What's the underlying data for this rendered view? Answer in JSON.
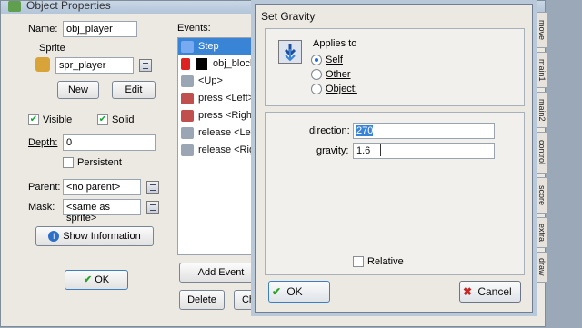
{
  "object_window": {
    "title": "Object Properties",
    "name_label": "Name:",
    "name_value": "obj_player",
    "sprite_label": "Sprite",
    "sprite_value": "spr_player",
    "new_label": "New",
    "edit_label": "Edit",
    "visible_label": "Visible",
    "solid_label": "Solid",
    "depth_label": "Depth:",
    "depth_value": "0",
    "persistent_label": "Persistent",
    "parent_label": "Parent:",
    "parent_value": "<no parent>",
    "mask_label": "Mask:",
    "mask_value": "<same as sprite>",
    "show_info_label": "Show Information",
    "ok_label": "OK",
    "events_label": "Events:",
    "events": [
      {
        "label": "Step",
        "icon": "step-icon"
      },
      {
        "label": "obj_block",
        "icon": "collision-icon"
      },
      {
        "label": "<Up>",
        "icon": "keyboard-icon"
      },
      {
        "label": "press <Left>",
        "icon": "key-press-icon"
      },
      {
        "label": "press <Right>",
        "icon": "key-press-icon"
      },
      {
        "label": "release <Left>",
        "icon": "key-release-icon"
      },
      {
        "label": "release <Right>",
        "icon": "key-release-icon"
      }
    ],
    "add_event_label": "Add Event",
    "delete_label": "Delete",
    "change_label": "Ch",
    "side_tabs": [
      "move",
      "main1",
      "main2",
      "control",
      "score",
      "extra",
      "draw"
    ]
  },
  "dialog": {
    "title": "Set Gravity",
    "applies_to_label": "Applies to",
    "radios": [
      {
        "label": "Self",
        "checked": true
      },
      {
        "label": "Other",
        "checked": false
      },
      {
        "label": "Object:",
        "checked": false
      }
    ],
    "direction_label": "direction:",
    "direction_value": "270",
    "gravity_label": "gravity:",
    "gravity_value": "1.6",
    "relative_label": "Relative",
    "ok_label": "OK",
    "cancel_label": "Cancel"
  }
}
